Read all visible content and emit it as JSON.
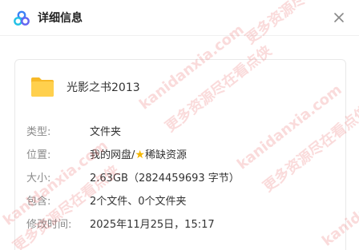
{
  "dialog": {
    "title": "详细信息",
    "close_icon": "close-icon",
    "app_icon": "cloud-drive-icon"
  },
  "file": {
    "icon": "folder-icon",
    "name": "光影之书2013"
  },
  "details": {
    "type_label": "类型:",
    "type_value": "文件夹",
    "location_label": "位置:",
    "location_prefix": "我的网盘/",
    "location_star": "★",
    "location_suffix": "稀缺资源",
    "size_label": "大小:",
    "size_value": "2.63GB（2824459693 字节）",
    "contains_label": "包含:",
    "contains_value": "2个文件、0个文件夹",
    "modified_label": "修改时间:",
    "modified_value": "2025年11月25日，15:17"
  },
  "watermarks": {
    "url": "kanidanxia.com",
    "cn": "更多资源尽在看点侠"
  },
  "colors": {
    "folder": "#ffc83d",
    "star": "#f5b700",
    "watermark": "#e85a5a"
  }
}
